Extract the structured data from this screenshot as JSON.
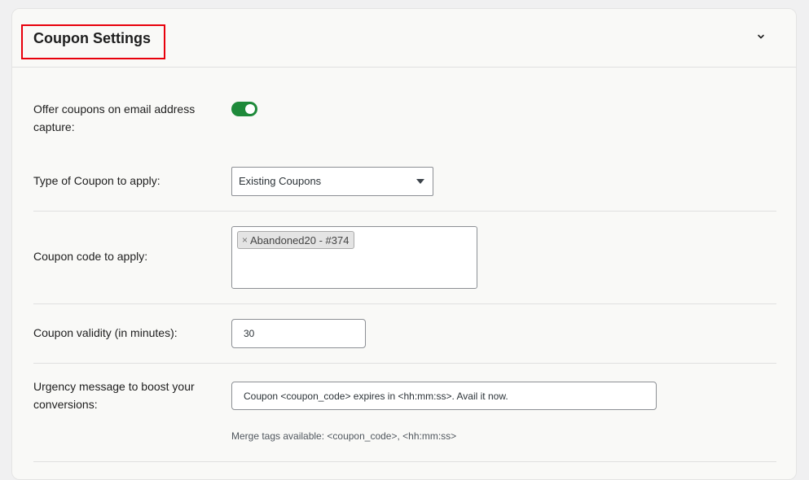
{
  "header": {
    "title": "Coupon Settings"
  },
  "fields": {
    "offer_coupons": {
      "label": "Offer coupons on email address capture:",
      "enabled": true
    },
    "coupon_type": {
      "label": "Type of Coupon to apply:",
      "selected": "Existing Coupons"
    },
    "coupon_code": {
      "label": "Coupon code to apply:",
      "chips": [
        {
          "remove": "×",
          "text": "Abandoned20 - #374"
        }
      ]
    },
    "coupon_validity": {
      "label": "Coupon validity (in minutes):",
      "value": "30"
    },
    "urgency_message": {
      "label": "Urgency message to boost your conversions:",
      "value": "Coupon <coupon_code> expires in <hh:mm:ss>. Avail it now.",
      "help": "Merge tags available: <coupon_code>, <hh:mm:ss>"
    }
  },
  "icons": {
    "collapse": "chevron-down-icon",
    "dropdown": "caret-down-icon"
  },
  "colors": {
    "toggle_on": "#1e8a3a",
    "highlight_border": "#e8000c"
  }
}
